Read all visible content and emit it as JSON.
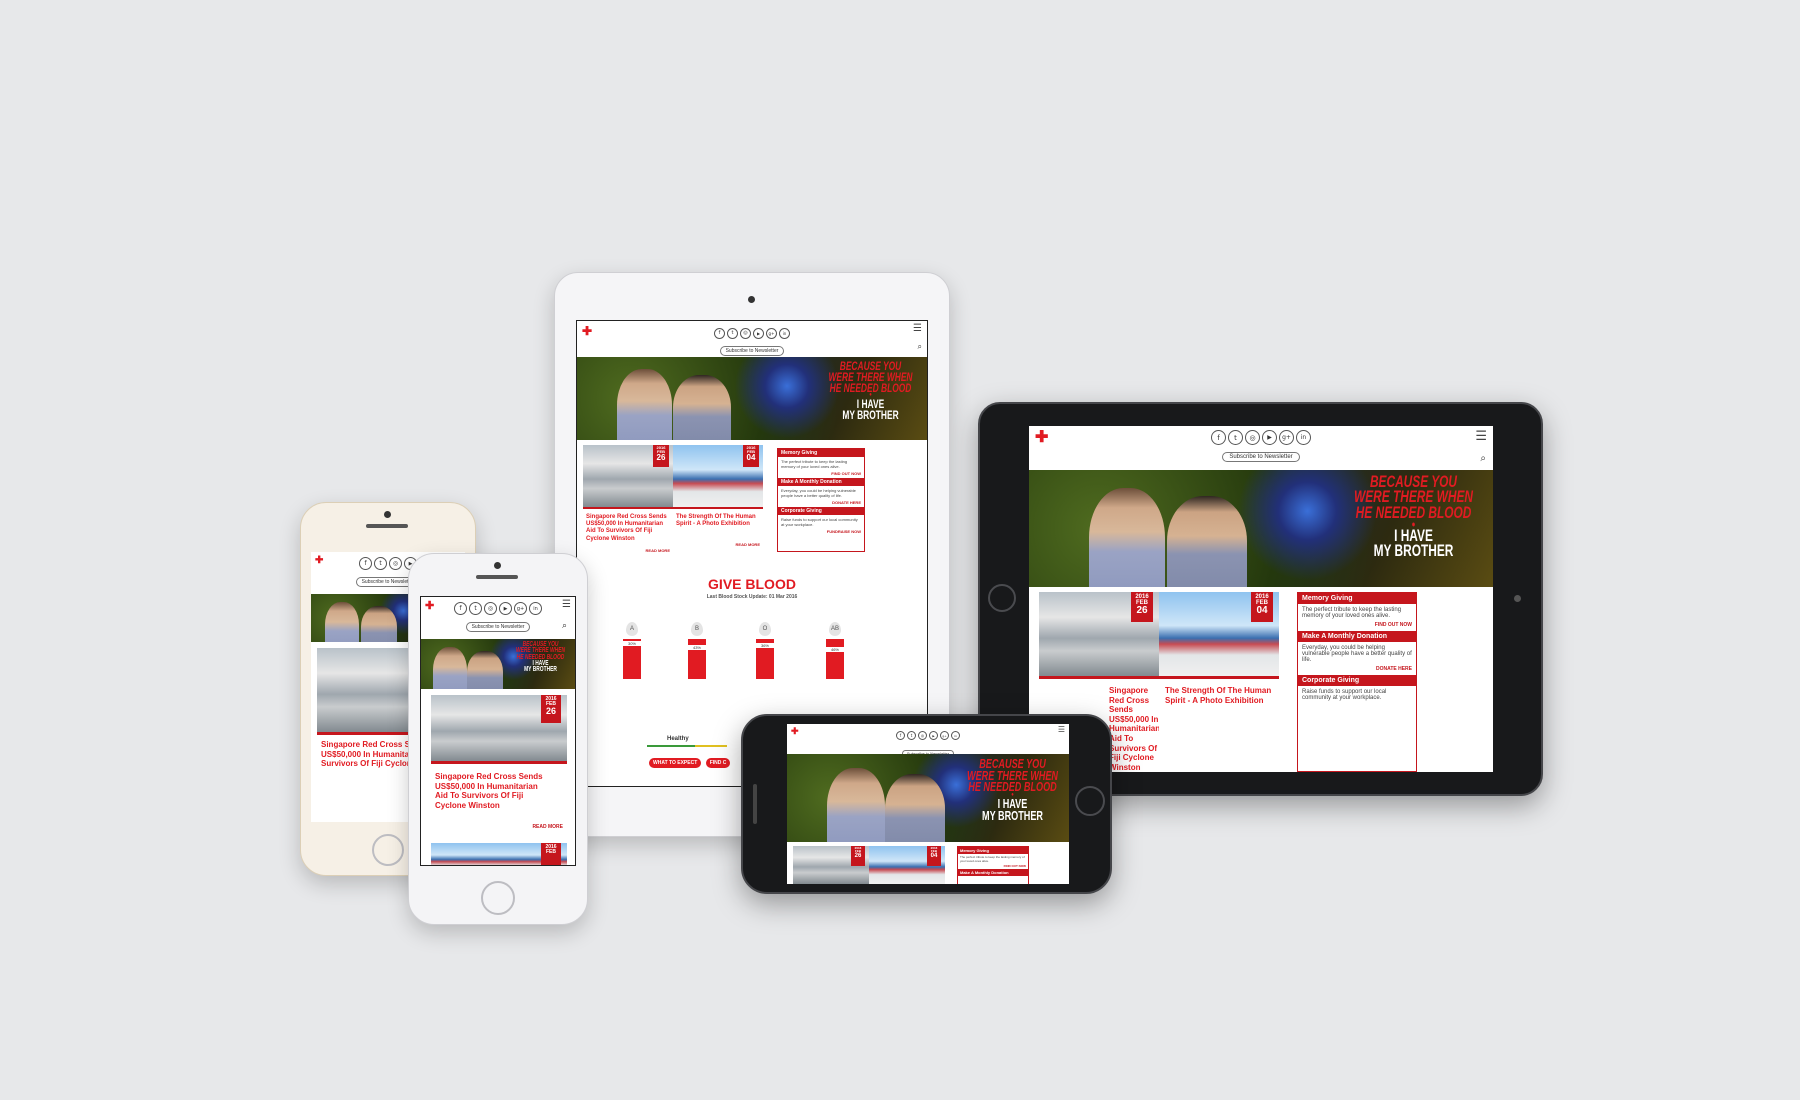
{
  "site": {
    "logo_glyph": "✚",
    "subscribe": "Subscribe to Newsletter",
    "menu_glyph": "☰",
    "search_glyph": "⌕",
    "social": [
      {
        "name": "facebook-icon",
        "glyph": "f"
      },
      {
        "name": "twitter-icon",
        "glyph": "t"
      },
      {
        "name": "instagram-icon",
        "glyph": "◎"
      },
      {
        "name": "youtube-icon",
        "glyph": "▶"
      },
      {
        "name": "googleplus-icon",
        "glyph": "g+"
      },
      {
        "name": "linkedin-icon",
        "glyph": "in"
      }
    ]
  },
  "hero": {
    "line1": "BECAUSE YOU",
    "line2": "WERE THERE WHEN",
    "line3": "HE NEEDED BLOOD",
    "drop": "●",
    "line4": "I HAVE",
    "line5": "MY BROTHER"
  },
  "news": [
    {
      "year": "2016",
      "month": "FEB",
      "day": "26",
      "title": "Singapore Red Cross Sends US$50,000 In Humanitarian Aid To Survivors Of Fiji Cyclone Winston",
      "read": "READ MORE"
    },
    {
      "year": "2016",
      "month": "FEB",
      "day": "04",
      "title": "The Strength Of The Human Spirit - A Photo Exhibition",
      "read": "READ MORE"
    }
  ],
  "side": [
    {
      "title": "Memory Giving",
      "text": "The perfect tribute to keep the lasting memory of your loved ones alive.",
      "link": "FIND OUT NOW"
    },
    {
      "title": "Make A Monthly Donation",
      "text": "Everyday, you could be helping vulnerable people have a better quality of life.",
      "link": "DONATE HERE"
    },
    {
      "title": "Corporate Giving",
      "text": "Raise funds to support our local community at your workplace.",
      "link": "FUNDRAISE NOW"
    }
  ],
  "give_blood": {
    "title": "GIVE BLOOD",
    "update": "Last Blood Stock Update: 01 Mar 2016",
    "types": [
      {
        "type": "A",
        "pct": "30%",
        "level": 0.3
      },
      {
        "type": "B",
        "pct": "43%",
        "level": 0.43
      },
      {
        "type": "O",
        "pct": "36%",
        "level": 0.36
      },
      {
        "type": "AB",
        "pct": "46%",
        "level": 0.46
      }
    ],
    "status": "Healthy",
    "btn1": "WHAT TO EXPECT",
    "btn2": "FIND C"
  }
}
